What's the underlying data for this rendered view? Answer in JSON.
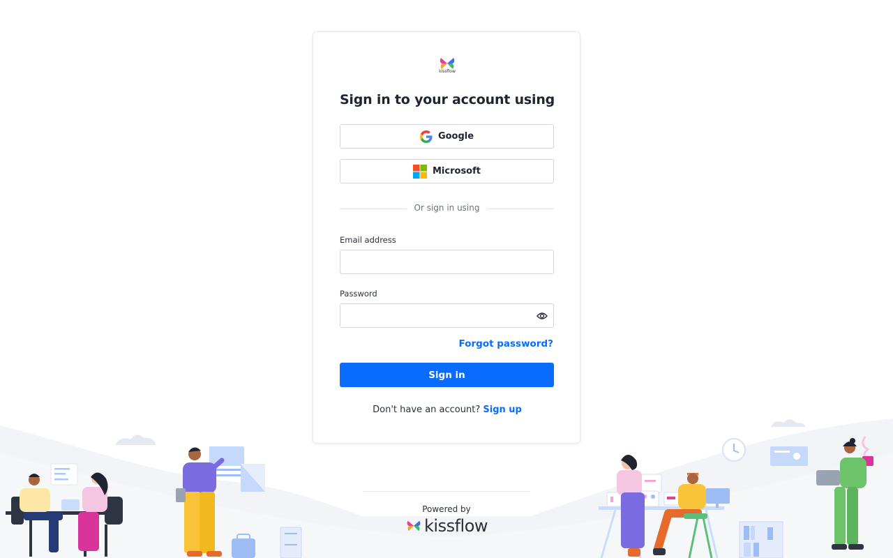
{
  "card": {
    "logo_word": "kissflow",
    "title": "Sign in to your account using",
    "google_label": "Google",
    "microsoft_label": "Microsoft",
    "divider_text": "Or sign in using",
    "email_label": "Email address",
    "email_value": "",
    "password_label": "Password",
    "password_value": "",
    "forgot_label": "Forgot password?",
    "signin_label": "Sign in",
    "signup_prompt": "Don't have an account?",
    "signup_link": "Sign up"
  },
  "footer": {
    "powered_by": "Powered by",
    "brand": "kissflow"
  },
  "icons": {
    "password_toggle": "eye-icon",
    "google": "google-icon",
    "microsoft": "microsoft-icon"
  },
  "colors": {
    "primary": "#0a6cff",
    "background": "#ffffff",
    "scene_ground": "#f3f4f7"
  }
}
